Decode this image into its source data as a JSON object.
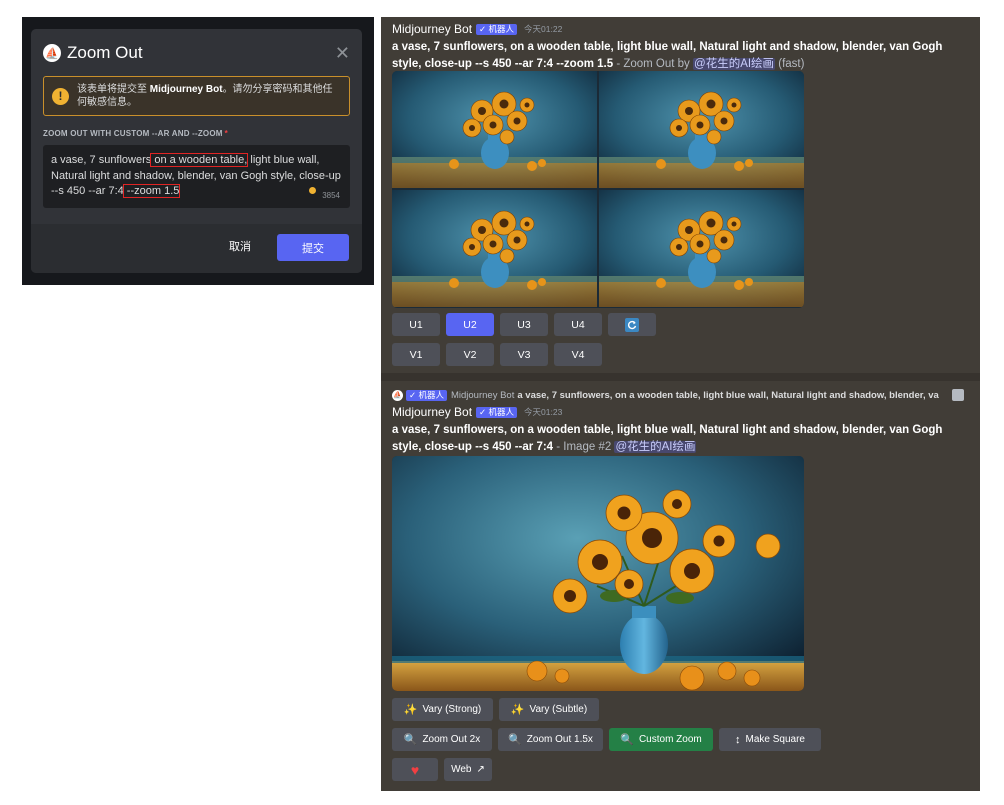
{
  "modal": {
    "title": "Zoom Out",
    "close_icon": "close-icon",
    "warning": {
      "prefix": "该表单将提交至 ",
      "bot_name": "Midjourney Bot",
      "suffix": "。请勿分享密码和其他任何敏感信息。"
    },
    "field_label": "ZOOM OUT WITH CUSTOM --AR AND --ZOOM",
    "required_mark": "*",
    "prompt_parts": [
      "a vase, 7 sunflowers",
      " on a wooden table,",
      " light blue wall, Natural light and shadow, blender, van Gogh style, close-up --s 450 --ar 7:4",
      " --zoom 1.5"
    ],
    "char_count": "3854",
    "cancel_label": "取消",
    "submit_label": "提交"
  },
  "message1": {
    "author": "Midjourney Bot",
    "bot_tag": "✓ 机器人",
    "timestamp": "今天01:22",
    "prompt_bold": "a vase, 7 sunflowers, on a wooden table, light blue wall, Natural light and shadow, blender, van Gogh style, close-up --s 450 --ar 7:4 --zoom 1.5",
    "suffix": " - Zoom Out by ",
    "mention": "@花生的AI绘画",
    "speed": " (fast)",
    "u_buttons": [
      "U1",
      "U2",
      "U3",
      "U4"
    ],
    "active_u": "U2",
    "refresh_icon": "refresh-icon",
    "v_buttons": [
      "V1",
      "V2",
      "V3",
      "V4"
    ]
  },
  "reply": {
    "bot_tag": "✓ 机器人",
    "name": "Midjourney Bot",
    "text": "a vase, 7 sunflowers, on a wooden table, light blue wall, Natural light and shadow, blender, va"
  },
  "message2": {
    "author": "Midjourney Bot",
    "bot_tag": "✓ 机器人",
    "timestamp": "今天01:23",
    "prompt_bold": "a vase, 7 sunflowers, on a wooden table, light blue wall, Natural light and shadow, blender, van Gogh style, close-up --s 450 --ar 7:4",
    "suffix": " - Image #2 ",
    "mention": "@花生的AI绘画",
    "buttons": {
      "vary_strong": "Vary (Strong)",
      "vary_subtle": "Vary (Subtle)",
      "zoom_out_2x": "Zoom Out 2x",
      "zoom_out_15x": "Zoom Out 1.5x",
      "custom_zoom": "Custom Zoom",
      "make_square": "Make Square",
      "web": "Web"
    }
  },
  "colors": {
    "blurple": "#5865f2",
    "green": "#248046",
    "warning": "#f0b232",
    "highlight_red": "#e02424"
  }
}
